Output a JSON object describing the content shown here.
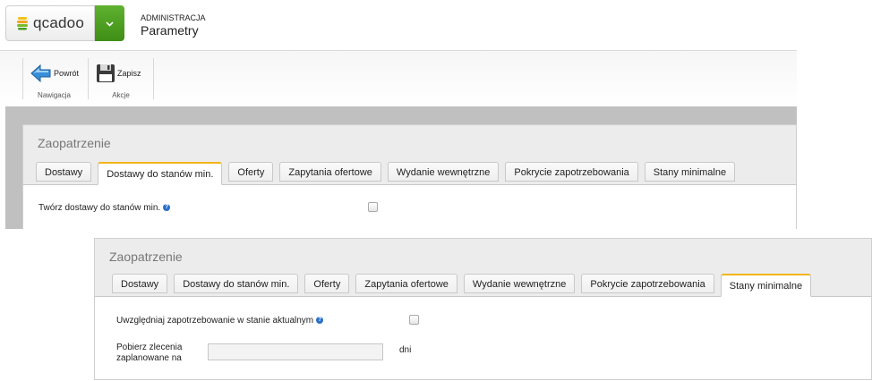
{
  "header": {
    "logo_text": "qcadoo",
    "section": "ADMINISTRACJA",
    "title": "Parametry"
  },
  "ribbon": {
    "groups": [
      {
        "label": "Nawigacja",
        "buttons": [
          {
            "label": "Powrót",
            "icon": "back-arrow-icon"
          }
        ]
      },
      {
        "label": "Akcje",
        "buttons": [
          {
            "label": "Zapisz",
            "icon": "floppy-disk-icon"
          }
        ]
      }
    ]
  },
  "panel1": {
    "title": "Zaopatrzenie",
    "tabs": [
      "Dostawy",
      "Dostawy do stanów min.",
      "Oferty",
      "Zapytania ofertowe",
      "Wydanie wewnętrzne",
      "Pokrycie zapotrzebowania",
      "Stany minimalne"
    ],
    "active_tab": "Dostawy do stanów min.",
    "fields": {
      "create_deliveries_label": "Twórz dostawy do stanów min.",
      "create_deliveries_checked": false
    }
  },
  "panel2": {
    "title": "Zaopatrzenie",
    "tabs": [
      "Dostawy",
      "Dostawy do stanów min.",
      "Oferty",
      "Zapytania ofertowe",
      "Wydanie wewnętrzne",
      "Pokrycie zapotrzebowania",
      "Stany minimalne"
    ],
    "active_tab": "Stany minimalne",
    "fields": {
      "include_demand_label": "Uwzględniaj zapotrzebowanie w stanie aktualnym",
      "include_demand_checked": false,
      "fetch_orders_label_line1": "Pobierz zlecenia",
      "fetch_orders_label_line2": "zaplanowane na",
      "fetch_orders_value": "",
      "fetch_orders_unit": "dni"
    }
  },
  "colors": {
    "brand_green": "#4a9e20",
    "active_tab_accent": "#f2b51b",
    "workspace_grey": "#c0c0c0",
    "help_icon_blue": "#2a6fc9"
  }
}
